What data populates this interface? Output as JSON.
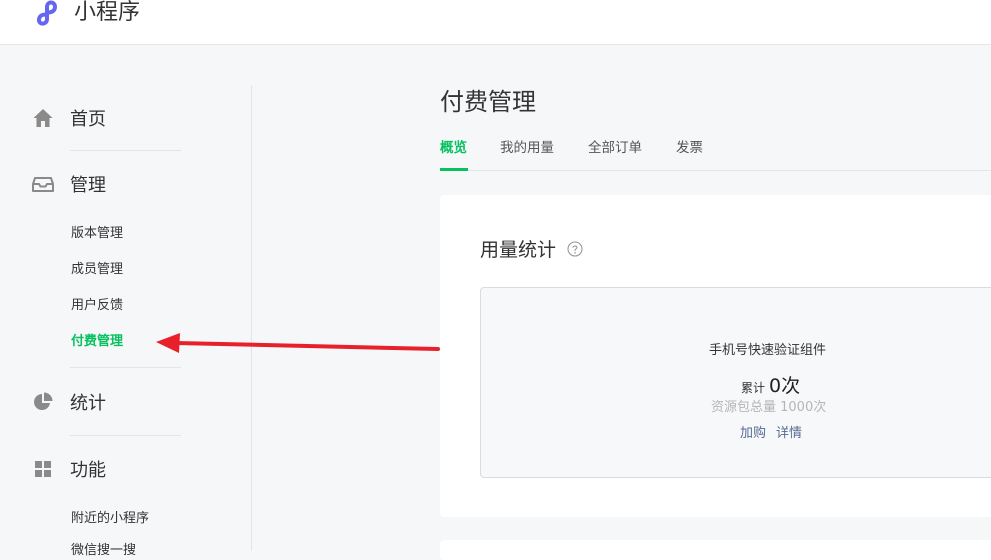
{
  "header": {
    "brand": "小程序",
    "logo_icon": "mini-program-logo-icon"
  },
  "sidebar": {
    "home": {
      "label": "首页",
      "icon": "home-icon"
    },
    "manage": {
      "label": "管理",
      "icon": "inbox-icon",
      "items": [
        {
          "label": "版本管理"
        },
        {
          "label": "成员管理"
        },
        {
          "label": "用户反馈"
        },
        {
          "label": "付费管理",
          "active": true
        }
      ]
    },
    "stats": {
      "label": "统计",
      "icon": "pie-chart-icon"
    },
    "features": {
      "label": "功能",
      "icon": "grid-icon",
      "items": [
        {
          "label": "附近的小程序"
        },
        {
          "label": "微信搜一搜"
        }
      ]
    }
  },
  "main": {
    "title": "付费管理",
    "tabs": [
      {
        "label": "概览",
        "active": true
      },
      {
        "label": "我的用量"
      },
      {
        "label": "全部订单"
      },
      {
        "label": "发票"
      }
    ],
    "usage": {
      "title": "用量统计",
      "help_icon": "help-circle-icon",
      "item_name": "手机号快速验证组件",
      "count_prefix": "累计",
      "count_value": "0次",
      "total_text": "资源包总量 1000次",
      "buy_label": "加购",
      "detail_label": "详情"
    }
  },
  "colors": {
    "accent": "#07c160",
    "link": "#576b95",
    "annotation_arrow": "#e8202a",
    "logo": "#6467f0"
  }
}
